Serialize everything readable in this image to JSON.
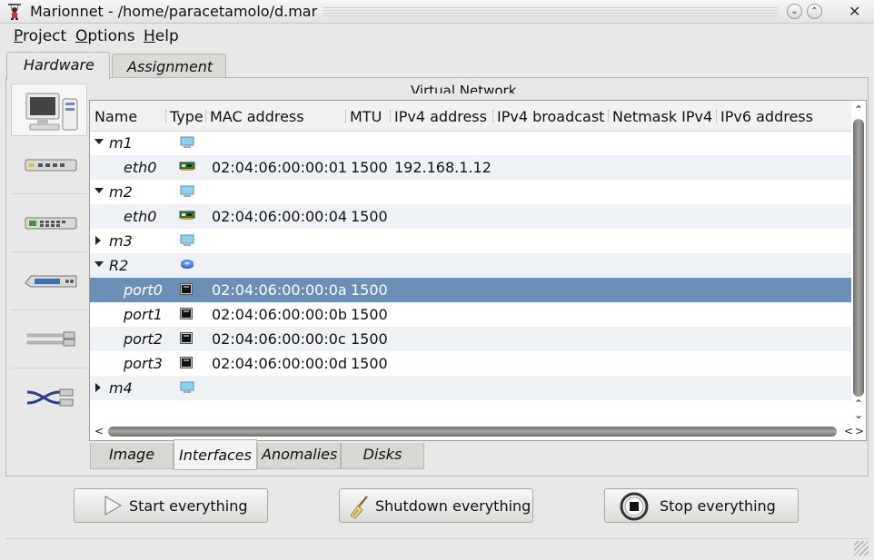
{
  "window": {
    "title": "Marionnet - /home/paracetamolo/d.mar",
    "app_icon": "puppet-icon",
    "buttons": [
      "minimize-button",
      "maximize-button",
      "close-button"
    ]
  },
  "menubar": {
    "items": [
      {
        "label": "Project",
        "mnemonic": "P"
      },
      {
        "label": "Options",
        "mnemonic": "O"
      },
      {
        "label": "Help",
        "mnemonic": "H"
      }
    ]
  },
  "main_tabs": [
    {
      "label": "Hardware",
      "active": true
    },
    {
      "label": "Assignment",
      "active": false
    }
  ],
  "palette": {
    "items": [
      "computer-icon",
      "hub-icon",
      "switch-icon",
      "router-icon",
      "cable-icon",
      "crossover-cable-icon"
    ]
  },
  "virtual_network_label": "Virtual Network",
  "table": {
    "columns": [
      "Name",
      "Type",
      "MAC address",
      "MTU",
      "IPv4 address",
      "IPv4 broadcast",
      "Netmask IPv4",
      "IPv6 address"
    ],
    "rows": [
      {
        "name": "m1",
        "level": 0,
        "expander": "open",
        "type_icon": "machine-icon",
        "mac": "",
        "mtu": "",
        "ipv4": "",
        "selected": false
      },
      {
        "name": "eth0",
        "level": 1,
        "expander": "",
        "type_icon": "network-card-icon",
        "mac": "02:04:06:00:00:01",
        "mtu": "1500",
        "ipv4": "192.168.1.12",
        "selected": false
      },
      {
        "name": "m2",
        "level": 0,
        "expander": "open",
        "type_icon": "machine-icon",
        "mac": "",
        "mtu": "",
        "ipv4": "",
        "selected": false
      },
      {
        "name": "eth0",
        "level": 1,
        "expander": "",
        "type_icon": "network-card-icon",
        "mac": "02:04:06:00:00:04",
        "mtu": "1500",
        "ipv4": "",
        "selected": false
      },
      {
        "name": "m3",
        "level": 0,
        "expander": "closed",
        "type_icon": "machine-icon",
        "mac": "",
        "mtu": "",
        "ipv4": "",
        "selected": false
      },
      {
        "name": "R2",
        "level": 0,
        "expander": "open",
        "type_icon": "router-icon",
        "mac": "",
        "mtu": "",
        "ipv4": "",
        "selected": false
      },
      {
        "name": "port0",
        "level": 1,
        "expander": "",
        "type_icon": "port-icon",
        "mac": "02:04:06:00:00:0a",
        "mtu": "1500",
        "ipv4": "",
        "selected": true
      },
      {
        "name": "port1",
        "level": 1,
        "expander": "",
        "type_icon": "port-icon",
        "mac": "02:04:06:00:00:0b",
        "mtu": "1500",
        "ipv4": "",
        "selected": false
      },
      {
        "name": "port2",
        "level": 1,
        "expander": "",
        "type_icon": "port-icon",
        "mac": "02:04:06:00:00:0c",
        "mtu": "1500",
        "ipv4": "",
        "selected": false
      },
      {
        "name": "port3",
        "level": 1,
        "expander": "",
        "type_icon": "port-icon",
        "mac": "02:04:06:00:00:0d",
        "mtu": "1500",
        "ipv4": "",
        "selected": false
      },
      {
        "name": "m4",
        "level": 0,
        "expander": "closed",
        "type_icon": "machine-icon",
        "mac": "",
        "mtu": "",
        "ipv4": "",
        "selected": false
      }
    ]
  },
  "bottom_tabs": [
    {
      "label": "Image",
      "active": false
    },
    {
      "label": "Interfaces",
      "active": true
    },
    {
      "label": "Anomalies",
      "active": false
    },
    {
      "label": "Disks",
      "active": false
    }
  ],
  "actions": [
    {
      "label": "Start everything",
      "icon": "play-icon"
    },
    {
      "label": "Shutdown everything",
      "icon": "broom-icon"
    },
    {
      "label": "Stop everything",
      "icon": "stop-icon"
    }
  ],
  "colors": {
    "selection": "#6b8fb7",
    "row_alt": "#eef2f7",
    "window_bg": "#e9e8e6"
  }
}
